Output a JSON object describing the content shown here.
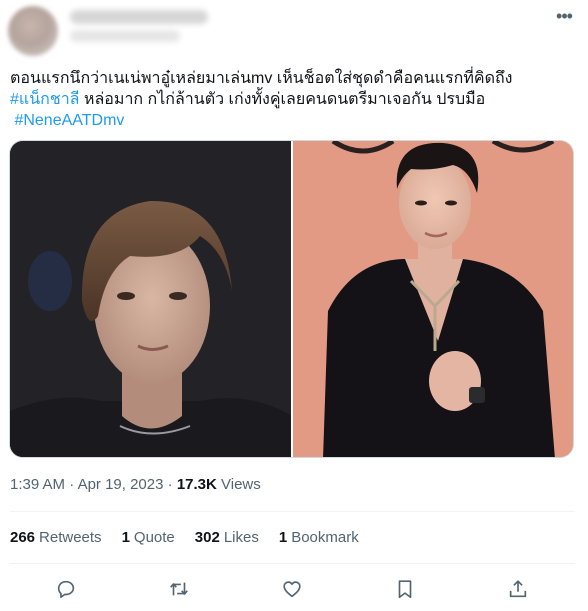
{
  "tweet": {
    "text_line1": "ตอนแรกนึกว่าเนเน่พาอู๋เหล่ยมาเล่นmv เห็นช็อตใส่ชุดดำคือคนแรกที่คิดถึง",
    "hashtag1": "#แน็กชาลี",
    "text_line2": " หล่อมาก กไก่ล้านตัว เก่งทั้งคู่เลยคนดนตรีมาเจอกัน ปรบมือ",
    "hashtag2": "#NeneAATDmv",
    "time": "1:39 AM",
    "date": "Apr 19, 2023",
    "views_count": "17.3K",
    "views_label": "Views",
    "separator": "·"
  },
  "stats": {
    "retweets_count": "266",
    "retweets_label": "Retweets",
    "quotes_count": "1",
    "quotes_label": "Quote",
    "likes_count": "302",
    "likes_label": "Likes",
    "bookmarks_count": "1",
    "bookmarks_label": "Bookmark"
  },
  "icons": {
    "more": "more-icon",
    "reply": "reply-icon",
    "retweet": "retweet-icon",
    "like": "like-icon",
    "bookmark": "bookmark-icon",
    "share": "share-icon"
  },
  "colors": {
    "accent": "#1d9bf0",
    "text": "#0f1419",
    "muted": "#536471"
  }
}
